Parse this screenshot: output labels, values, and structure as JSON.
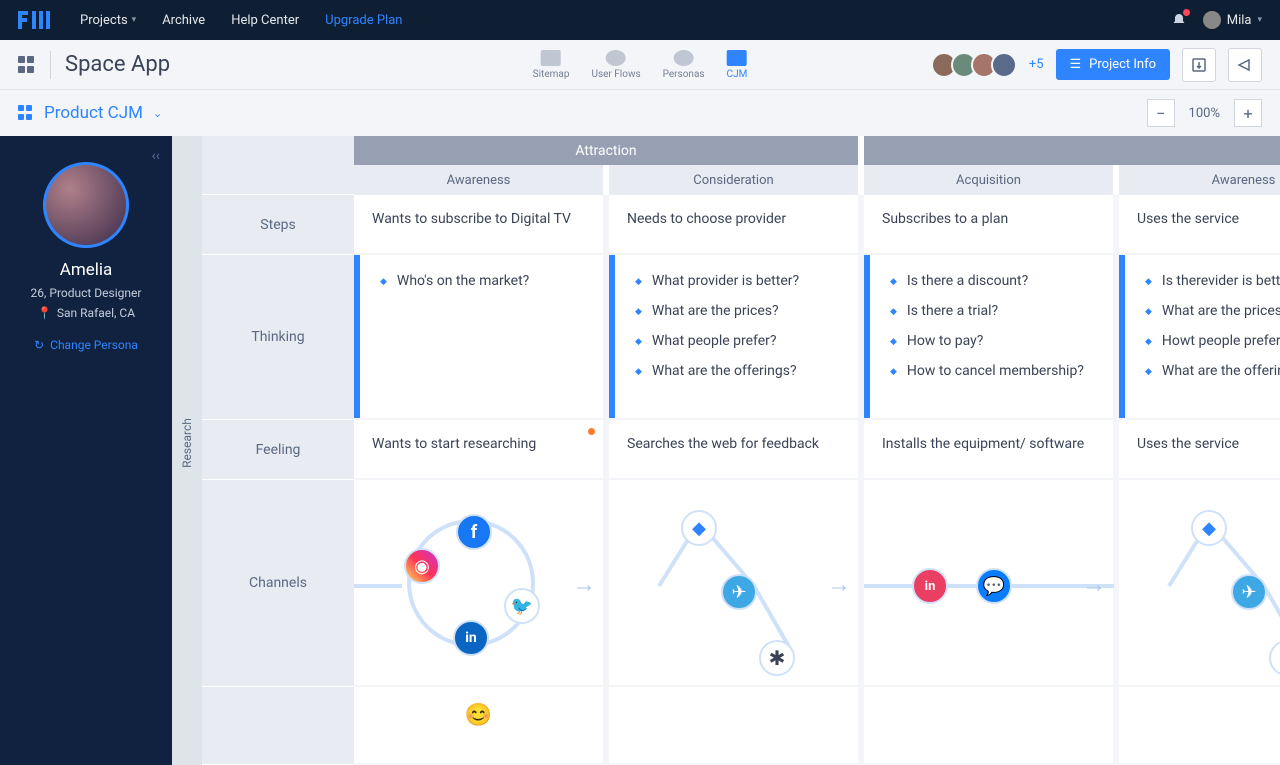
{
  "nav": {
    "items": [
      "Projects",
      "Archive",
      "Help Center"
    ],
    "upgrade": "Upgrade Plan",
    "user": "Mila"
  },
  "project": {
    "title": "Space App",
    "tabs": [
      "Sitemap",
      "User Flows",
      "Personas",
      "CJM"
    ],
    "avatarsPlus": "+5",
    "infoBtn": "Project Info"
  },
  "subbar": {
    "title": "Product CJM",
    "zoom": "100%"
  },
  "persona": {
    "name": "Amelia",
    "role": "26, Product Designer",
    "location": "San Rafael, CA",
    "change": "Change Persona"
  },
  "vtab": "Research",
  "rowLabels": [
    "Steps",
    "Thinking",
    "Feeling",
    "Channels"
  ],
  "phases": [
    "Attraction",
    ""
  ],
  "substages": [
    "Awareness",
    "Consideration",
    "Acquisition",
    "Awareness"
  ],
  "steps": [
    "Wants to subscribe to Digital TV",
    "Needs to choose provider",
    "Subscribes to a plan",
    "Uses the service"
  ],
  "thinking": [
    [
      "Who's on the market?"
    ],
    [
      "What provider is better?",
      "What are the prices?",
      "What people prefer?",
      "What are the offerings?"
    ],
    [
      "Is there a discount?",
      "Is there a trial?",
      "How to pay?",
      "How to cancel membership?"
    ],
    [
      "Is therevider is better?",
      "What are the prices?",
      "Howt people prefer?",
      "What are the offerings?"
    ]
  ],
  "feeling": [
    "Wants to start researching",
    "Searches the web for feedback",
    "Installs the equipment/ software",
    "Uses the service"
  ],
  "channels": {
    "col1": [
      "instagram",
      "facebook",
      "linkedin",
      "twitter"
    ],
    "col2": [
      "diamond",
      "telegram",
      "slack"
    ],
    "col3": [
      "invision",
      "messenger"
    ],
    "col4": [
      "diamond",
      "telegram",
      "slack"
    ]
  }
}
